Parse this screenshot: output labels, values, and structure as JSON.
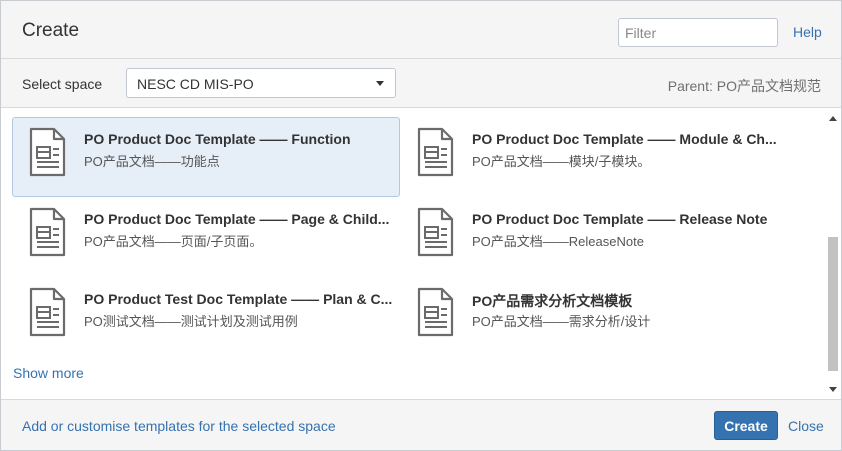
{
  "dialog": {
    "title": "Create",
    "filter_placeholder": "Filter",
    "help_label": "Help"
  },
  "space": {
    "label": "Select space",
    "selected": "NESC CD MIS-PO",
    "parent": "Parent: PO产品文档规范"
  },
  "templates": [
    {
      "name": "PO Product Doc Template —— Function",
      "desc": "PO产品文档——功能点",
      "selected": true
    },
    {
      "name": "PO Product Doc Template —— Module & Ch...",
      "desc": "PO产品文档——模块/子模块。",
      "selected": false
    },
    {
      "name": "PO Product Doc Template —— Page & Child...",
      "desc": "PO产品文档——页面/子页面。",
      "selected": false
    },
    {
      "name": "PO Product Doc Template —— Release Note",
      "desc": "PO产品文档——ReleaseNote",
      "selected": false
    },
    {
      "name": "PO Product Test Doc Template —— Plan & C...",
      "desc": "PO测试文档——测试计划及测试用例",
      "selected": false
    },
    {
      "name": "PO产品需求分析文档模板",
      "desc": "PO产品文档——需求分析/设计",
      "selected": false
    }
  ],
  "show_more_label": "Show more",
  "footer": {
    "customise_label": "Add or customise templates for the selected space",
    "create_label": "Create",
    "close_label": "Close"
  },
  "icons": {
    "template": "document-template-icon",
    "dropdown": "chevron-down-icon"
  },
  "colors": {
    "link": "#3572b0",
    "primary_button": "#3572b0",
    "selected_bg": "#e6eef7"
  }
}
